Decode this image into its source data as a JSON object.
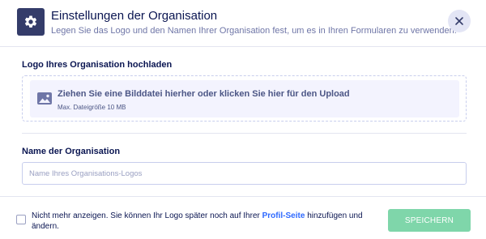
{
  "header": {
    "title": "Einstellungen der Organisation",
    "subtitle": "Legen Sie das Logo und den Namen Ihrer Organisation fest, um es in Ihren Formularen zu verwenden.",
    "icon": "gear-icon",
    "close_icon": "close-icon"
  },
  "logo_section": {
    "label": "Logo Ihres Organisation hochladen",
    "upload_text": "Ziehen Sie eine Bilddatei hierher oder klicken Sie hier für den Upload",
    "upload_hint": "Max. Dateigröße 10 MB",
    "icon": "image-icon"
  },
  "name_section": {
    "label": "Name der Organisation",
    "value": "",
    "placeholder": "Name Ihres Organisations-Logos"
  },
  "footer": {
    "checkbox_checked": false,
    "text_before": "Nicht mehr anzeigen. Sie können Ihr Logo später noch auf Ihrer ",
    "link_text": "Profil-Seite",
    "text_after": " hinzufügen und ändern.",
    "save_label": "SPEICHERN"
  },
  "colors": {
    "accent": "#343c6a",
    "save_button": "#7fd6aa",
    "link": "#2e69ff",
    "upload_bg": "#f3f3fe"
  }
}
